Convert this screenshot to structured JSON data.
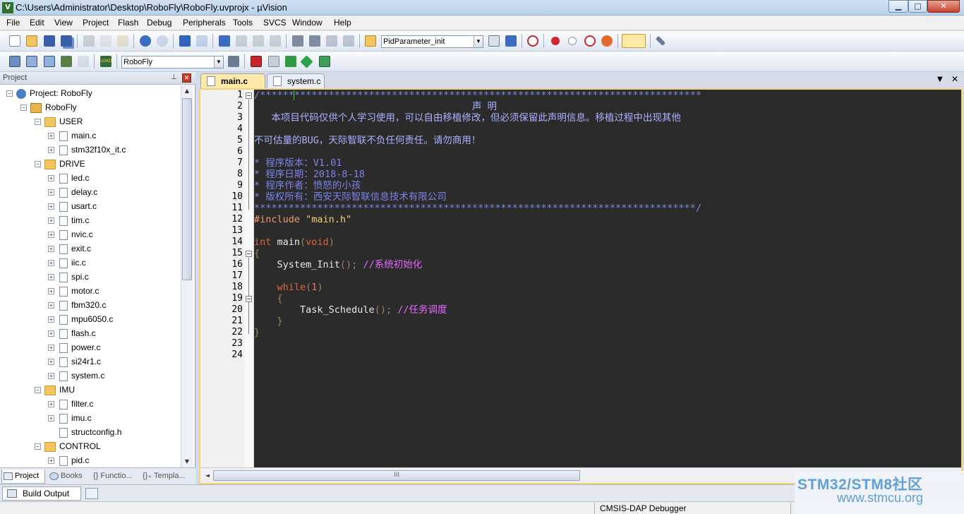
{
  "window": {
    "title": "C:\\Users\\Administrator\\Desktop\\RoboFly\\RoboFly.uvprojx - µVision",
    "min_glyph": "▁",
    "max_glyph": "□",
    "close_glyph": "✕"
  },
  "menu": [
    "File",
    "Edit",
    "View",
    "Project",
    "Flash",
    "Debug",
    "Peripherals",
    "Tools",
    "SVCS",
    "Window",
    "Help"
  ],
  "toolbar": {
    "function_combo": "PidParameter_init",
    "target_combo": "RoboFly",
    "combo_arrow": "▼"
  },
  "project_panel": {
    "title": "Project",
    "pin": "⊥",
    "close": "✕",
    "tree": {
      "project": "Project: RoboFly",
      "target": "RoboFly",
      "groups": [
        {
          "name": "USER",
          "files": [
            "main.c",
            "stm32f10x_it.c"
          ]
        },
        {
          "name": "DRIVE",
          "files": [
            "led.c",
            "delay.c",
            "usart.c",
            "tim.c",
            "nvic.c",
            "exit.c",
            "iic.c",
            "spi.c",
            "motor.c",
            "fbm320.c",
            "mpu6050.c",
            "flash.c",
            "power.c",
            "si24r1.c",
            "system.c"
          ]
        },
        {
          "name": "IMU",
          "files": [
            "filter.c",
            "imu.c",
            "structconfig.h"
          ]
        },
        {
          "name": "CONTROL",
          "files": [
            "pid.c"
          ]
        }
      ]
    },
    "tabs": [
      "Project",
      "Books",
      "{} Functio...",
      "{}₊ Templa..."
    ]
  },
  "editor": {
    "tabs": [
      {
        "label": "main.c",
        "active": true
      },
      {
        "label": "system.c",
        "active": false
      }
    ],
    "tab_menu": "▼",
    "tab_close": "✕",
    "line_count": 24,
    "hscroll_grip": "III"
  },
  "code": {
    "l1": "/*****************************************************************************",
    "l2": "                                      声 明",
    "l3": "   本项目代码仅供个人学习使用，可以自由移植修改，但必须保留此声明信息。移植过程中出现其他",
    "l4": "",
    "l5": "不可估量的BUG，天际智联不负任何责任。请勿商用！",
    "l6": "",
    "l7": "* 程序版本：V1.01",
    "l8": "* 程序日期：2018-8-18",
    "l9": "* 程序作者：愤怒的小孩",
    "l10": "* 版权所有：西安天际智联信息技术有限公司",
    "l11": "*****************************************************************************/",
    "l12_pre": "#include ",
    "l12_str": "\"main.h\"",
    "l14_kw": "int",
    "l14_fn": " main",
    "l14_po": "(",
    "l14_kw2": "void",
    "l14_pc": ")",
    "l15": "{",
    "l16_fn": "    System_Init",
    "l16_p": "(); ",
    "l16_cmt": "//系统初始化",
    "l18_kw": "    while",
    "l18_po": "(",
    "l18_num": "1",
    "l18_pc": ")",
    "l19": "    {",
    "l20_fn": "        Task_Schedule",
    "l20_p": "(); ",
    "l20_cmt": "//任务调度",
    "l21": "    }",
    "l22": "}"
  },
  "build_output": {
    "label": "Build Output"
  },
  "status": {
    "debugger": "CMSIS-DAP Debugger"
  },
  "watermark": {
    "line1": "STM32/STM8社区",
    "line2": "www.stmcu.org"
  },
  "colors": {
    "editor_bg": "#2b2b2b",
    "comment": "#7b83e8",
    "keyword": "#e0623e",
    "string": "#f3cf70",
    "preprocessor": "#f29a6a",
    "line_comment": "#e566ff",
    "active_tab": "#ffe9a8"
  }
}
